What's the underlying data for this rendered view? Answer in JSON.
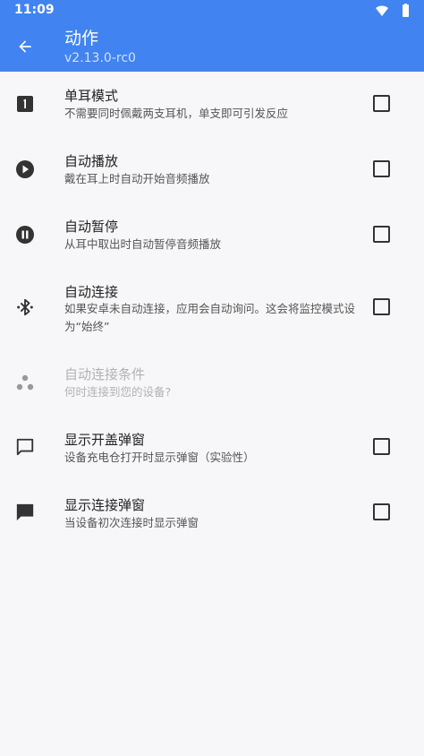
{
  "status_bar": {
    "time": "11:09",
    "icons": [
      "wifi-icon",
      "battery-icon"
    ]
  },
  "app_bar": {
    "title": "动作",
    "subtitle": "v2.13.0-rc0",
    "back_icon": "arrow-back-icon"
  },
  "colors": {
    "primary": "#4184f1",
    "background": "#f7f7f9",
    "disabled_text": "#b2b2b6"
  },
  "settings": [
    {
      "icon": "one-ear-icon",
      "title": "单耳模式",
      "subtitle": "不需要同时佩戴两支耳机，单支即可引发反应",
      "checked": false,
      "enabled": true
    },
    {
      "icon": "play-circle-icon",
      "title": "自动播放",
      "subtitle": "戴在耳上时自动开始音频播放",
      "checked": false,
      "enabled": true
    },
    {
      "icon": "pause-circle-icon",
      "title": "自动暂停",
      "subtitle": "从耳中取出时自动暂停音频播放",
      "checked": false,
      "enabled": true
    },
    {
      "icon": "bluetooth-searching-icon",
      "title": "自动连接",
      "subtitle": "如果安卓未自动连接，应用会自动询问。这会将监控模式设为“始终”",
      "checked": false,
      "enabled": true
    },
    {
      "icon": "dots-cluster-icon",
      "title": "自动连接条件",
      "subtitle": "何时连接到您的设备?",
      "enabled": false
    },
    {
      "icon": "chat-outline-icon",
      "title": "显示开盖弹窗",
      "subtitle": "设备充电仓打开时显示弹窗（实验性）",
      "checked": false,
      "enabled": true
    },
    {
      "icon": "chat-filled-icon",
      "title": "显示连接弹窗",
      "subtitle": "当设备初次连接时显示弹窗",
      "checked": false,
      "enabled": true
    }
  ]
}
